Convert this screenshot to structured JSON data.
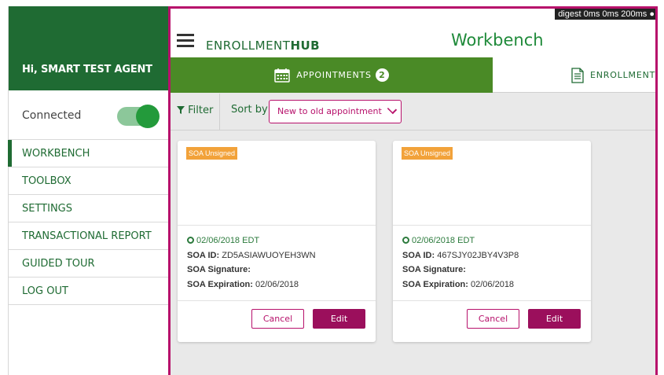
{
  "sidebar": {
    "greeting": "Hi, SMART TEST AGENT",
    "connected_label": "Connected",
    "connected_on": true,
    "items": [
      {
        "label": "WORKBENCH",
        "active": true
      },
      {
        "label": "TOOLBOX"
      },
      {
        "label": "SETTINGS"
      },
      {
        "label": "TRANSACTIONAL REPORT"
      },
      {
        "label": "GUIDED TOUR"
      },
      {
        "label": "LOG OUT"
      }
    ]
  },
  "header": {
    "brand_light": "ENROLLMENT",
    "brand_bold": "HUB",
    "title": "Workbench",
    "digest": "digest 0ms 0ms 200ms ●"
  },
  "tabs": {
    "appointments_label": "APPOINTMENTS",
    "appointments_count": "2",
    "enrollment_label": "ENROLLMENT A"
  },
  "filterbar": {
    "filter_label": "Filter",
    "sort_label": "Sort by",
    "sort_value": "New to old appointment"
  },
  "cards": [
    {
      "badge": "SOA Unsigned",
      "date": "02/06/2018 EDT",
      "soa_id_label": "SOA ID:",
      "soa_id": "ZD5ASIAWUOYEH3WN",
      "signature_label": "SOA Signature:",
      "signature": "",
      "expiration_label": "SOA Expiration:",
      "expiration": "02/06/2018",
      "cancel_label": "Cancel",
      "edit_label": "Edit"
    },
    {
      "badge": "SOA Unsigned",
      "date": "02/06/2018 EDT",
      "soa_id_label": "SOA ID:",
      "soa_id": "467SJY02JBY4V3P8",
      "signature_label": "SOA Signature:",
      "signature": "",
      "expiration_label": "SOA Expiration:",
      "expiration": "02/06/2018",
      "cancel_label": "Cancel",
      "edit_label": "Edit"
    }
  ],
  "colors": {
    "brand_green": "#1f6b33",
    "tab_green": "#4a8a26",
    "accent_magenta": "#b7116b",
    "badge_orange": "#f2a23a"
  }
}
